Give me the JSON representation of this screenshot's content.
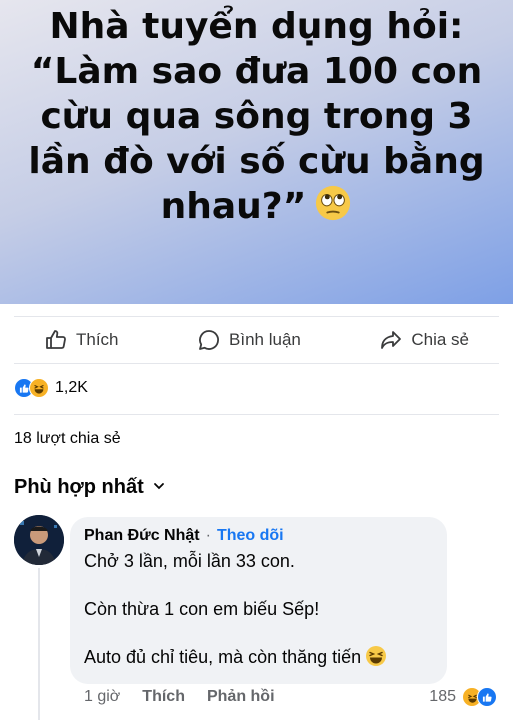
{
  "post": {
    "banner_lines": [
      "Nhà tuyển dụng hỏi:",
      "“Làm sao đưa 100 con",
      "cừu qua sông trong 3",
      "lần đò với số cừu bằng",
      "nhau?”"
    ],
    "banner_emoji": "rolling-eyes-emoji"
  },
  "actions": {
    "like_label": "Thích",
    "comment_label": "Bình luận",
    "share_label": "Chia sẻ"
  },
  "reactions": {
    "icons": [
      "like",
      "haha"
    ],
    "count": "1,2K"
  },
  "shares_text": "18 lượt chia sẻ",
  "sort_label": "Phù hợp nhất",
  "comment": {
    "author": "Phan Đức Nhật",
    "separator": "·",
    "follow_label": "Theo dõi",
    "lines": [
      "Chở 3 lần, mỗi lần 33 con.",
      "Còn thừa 1 con em biếu Sếp!",
      "Auto đủ chỉ tiêu, mà còn thăng tiến"
    ],
    "time": "1 giờ",
    "like_label": "Thích",
    "reply_label": "Phản hồi",
    "reaction_count": "185"
  },
  "colors": {
    "accent": "#1877f2",
    "muted": "#65676b",
    "bubble": "#f0f2f5",
    "haha": "#f7b125"
  }
}
